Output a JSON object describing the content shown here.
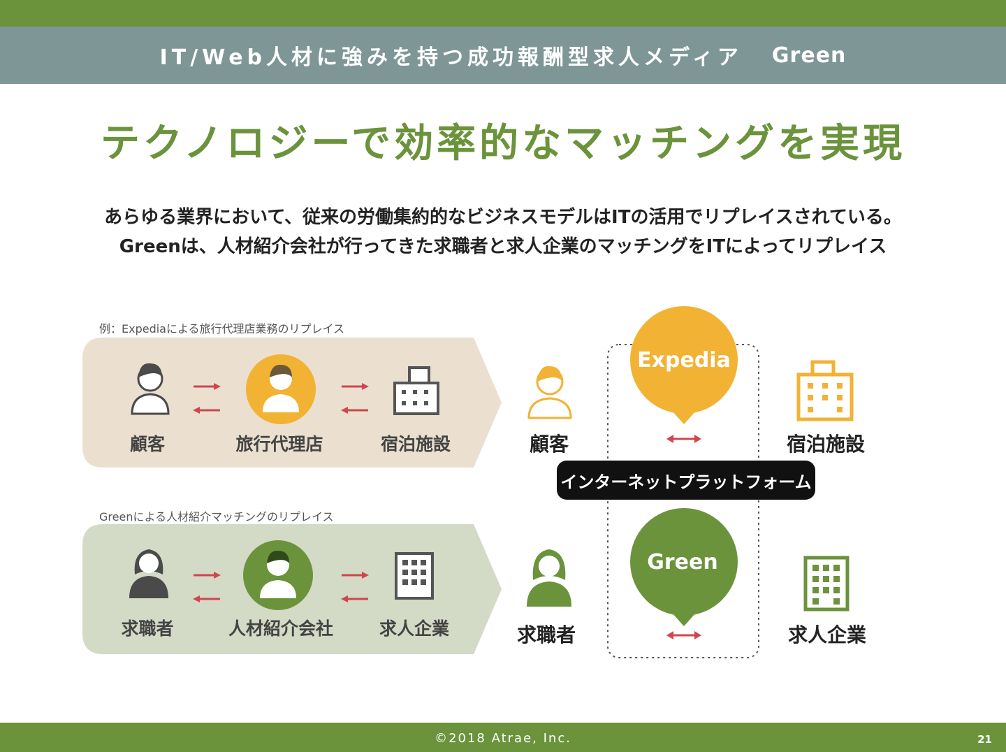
{
  "header": {
    "tagline": "IT/Web人材に強みを持つ成功報酬型求人メディア",
    "brand": "Green"
  },
  "main_title": "テクノロジーで効率的なマッチングを実現",
  "lead": {
    "line1": "あらゆる業界において、従来の労働集約的なビジネスモデルはITの活用でリプレイスされている。",
    "line2": "Greenは、人材紹介会社が行ってきた求職者と求人企業のマッチングをITによってリプレイス"
  },
  "example_expedia": {
    "caption": "例：Expediaによる旅行代理店業務のリプレイス",
    "left_label": "顧客",
    "middle_label": "旅行代理店",
    "right_label": "宿泊施設"
  },
  "example_green": {
    "caption": "Greenによる人材紹介マッチングのリプレイス",
    "left_label": "求職者",
    "middle_label": "人材紹介会社",
    "right_label": "求人企業"
  },
  "platform": {
    "label": "インターネットプラットフォーム",
    "expedia": {
      "bubble_text": "Expedia",
      "left_label": "顧客",
      "right_label": "宿泊施設"
    },
    "green": {
      "bubble_text": "Green",
      "left_label": "求職者",
      "right_label": "求人企業"
    }
  },
  "footer": {
    "copyright": "©2018 Atrae, Inc.",
    "page_number": "21"
  },
  "colors": {
    "brand_green": "#6b933c",
    "header_gray": "#7f9696",
    "expedia_orange": "#f2b233",
    "arrow_red": "#d0454f",
    "panel_beige": "#ebe0cf",
    "panel_green": "#d3dac6",
    "icon_dark": "#4a4a4a"
  },
  "icons": [
    "person-icon",
    "agent-icon",
    "building-icon",
    "double-arrow-icon"
  ]
}
